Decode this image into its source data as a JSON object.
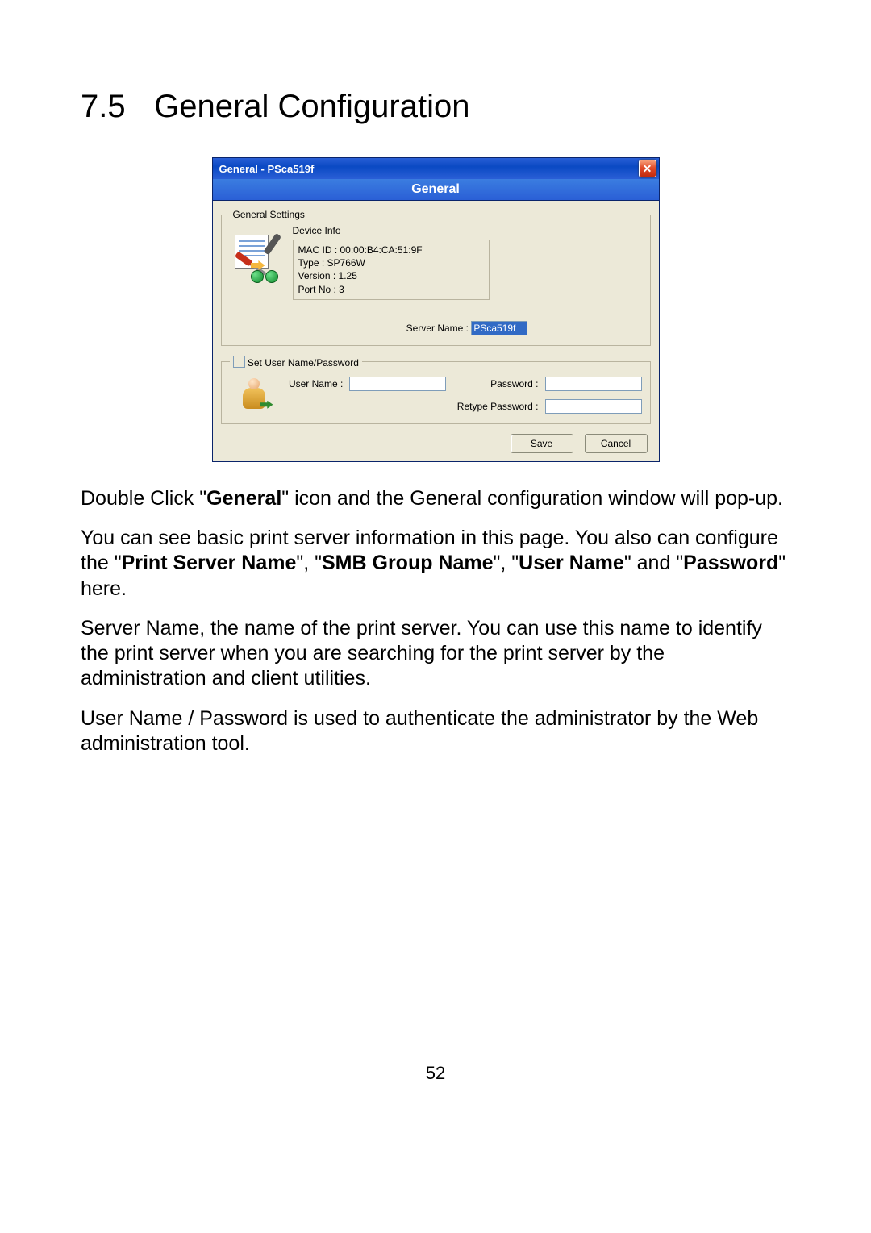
{
  "heading": {
    "number": "7.5",
    "title": "General Configuration"
  },
  "window": {
    "title": "General - PSca519f",
    "close_glyph": "✕",
    "banner": "General",
    "group_settings_legend": "General Settings",
    "device_info_label": "Device Info",
    "device_info": {
      "mac": "MAC ID : 00:00:B4:CA:51:9F",
      "type": "Type : SP766W",
      "version": "Version : 1.25",
      "port": "Port No : 3"
    },
    "server_name_label": "Server Name :",
    "server_name_value": "PSca519f",
    "set_userpass_label": "Set User Name/Password",
    "user_name_label": "User Name :",
    "password_label": "Password :",
    "retype_password_label": "Retype Password :",
    "user_name_value": "",
    "password_value": "",
    "retype_password_value": "",
    "buttons": {
      "save": "Save",
      "cancel": "Cancel"
    }
  },
  "body": {
    "p1_a": "Double Click \"",
    "p1_b": "General",
    "p1_c": "\" icon and the General configuration window will pop-up.",
    "p2_a": "You can see basic print server information in this page. You also can configure the \"",
    "p2_b": "Print Server Name",
    "p2_c": "\", \"",
    "p2_d": "SMB Group Name",
    "p2_e": "\", \"",
    "p2_f": "User Name",
    "p2_g": "\" and \"",
    "p2_h": "Password",
    "p2_i": "\" here.",
    "p3": "Server Name, the name of the print server. You can use this name to identify the print server when you are searching for the print server by the administration and client utilities.",
    "p4": "User Name / Password is used to authenticate the administrator by the Web administration tool."
  },
  "page_number": "52"
}
